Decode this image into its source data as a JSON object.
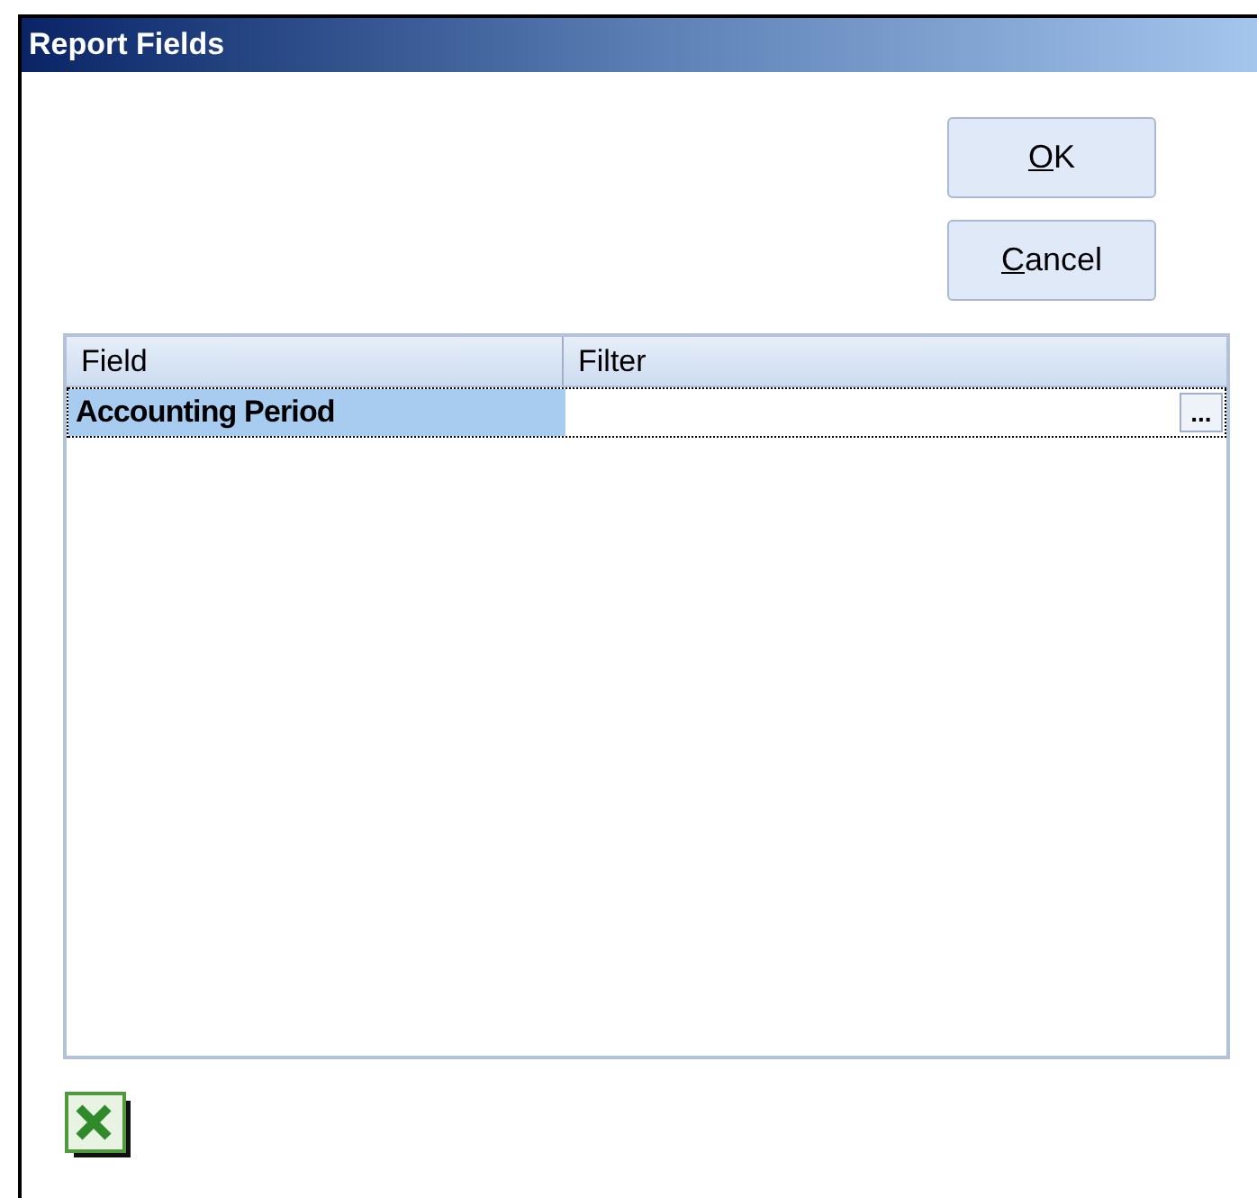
{
  "window": {
    "title": "Report Fields"
  },
  "buttons": [
    {
      "label": "OK",
      "mnemonic": true
    },
    {
      "label": "Cancel",
      "mnemonic": true
    }
  ],
  "table": {
    "columns": [
      "Field",
      "Filter"
    ],
    "rows": [
      {
        "field": "Accounting Period",
        "filter_button": "...",
        "selected": true
      }
    ]
  }
}
